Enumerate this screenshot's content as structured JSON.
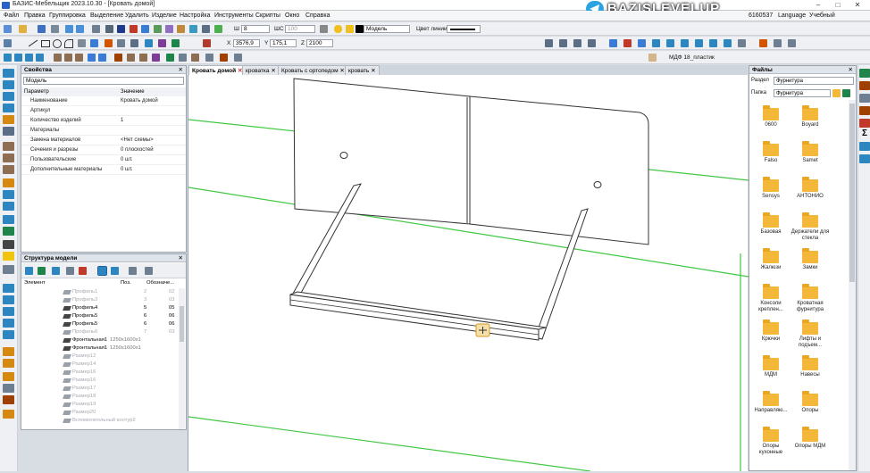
{
  "window": {
    "title": "БАЗИС-Мебельщик 2023.10.30 - [Кровать домой]",
    "account_id": "6160537",
    "language": "Language",
    "mode": "Учебный"
  },
  "banner": {
    "text": "BAZISLEVELUP"
  },
  "menu": [
    "Файл",
    "Правка",
    "Группировка",
    "Выделение",
    "Удалить",
    "Изделие",
    "Настройка",
    "Инструменты",
    "Скрипты",
    "Окно",
    "Справка"
  ],
  "toolbar": {
    "width_label": "Ш",
    "width_value": "8",
    "shs_label": "ШС",
    "shs_value": "100",
    "layer_value": "Модель",
    "line_color_label": "Цвет линии"
  },
  "coords": {
    "x_label": "X",
    "x": "3576,9",
    "y_label": "Y",
    "y": "175,1",
    "z_label": "Z",
    "z": "2100"
  },
  "material": "МДФ 18_пластик",
  "properties": {
    "title": "Свойства",
    "selector": "Модель",
    "col_param": "Параметр",
    "col_value": "Значение",
    "rows": [
      {
        "k": "Наименование",
        "v": "Кровать домой"
      },
      {
        "k": "Артикул",
        "v": ""
      },
      {
        "k": "Количество изделий",
        "v": "1"
      },
      {
        "k": "Материалы",
        "v": ""
      },
      {
        "k": "Замена материалов",
        "v": "<Нет схемы>"
      },
      {
        "k": "Сечения и разрезы",
        "v": "0 плоскостей"
      },
      {
        "k": "Пользовательские",
        "v": "0 шт."
      },
      {
        "k": "Дополнительные материалы",
        "v": "0 шт."
      }
    ]
  },
  "structure": {
    "title": "Структура модели",
    "col_element": "Элемент",
    "col_pos": "Поз.",
    "col_des": "Обозначе...",
    "rows": [
      {
        "n": "Профиль1",
        "p": "2",
        "d": "02",
        "g": true
      },
      {
        "n": "Профиль3",
        "p": "3",
        "d": "03",
        "g": true
      },
      {
        "n": "Профиль4",
        "p": "5",
        "d": "05",
        "g": false
      },
      {
        "n": "Профиль5",
        "p": "6",
        "d": "06",
        "g": false
      },
      {
        "n": "Профиль5",
        "p": "6",
        "d": "06",
        "g": false
      },
      {
        "n": "Профиль6",
        "p": "7",
        "d": "03",
        "g": true
      },
      {
        "n": "Фронтальная1",
        "p": "",
        "d": "",
        "g": false,
        "dim": "1250x1600x1"
      },
      {
        "n": "Фронтальная1",
        "p": "",
        "d": "",
        "g": false,
        "dim": "1250x1600x1"
      },
      {
        "n": "Размер12",
        "p": "",
        "d": "",
        "g": true
      },
      {
        "n": "Размер14",
        "p": "",
        "d": "",
        "g": true
      },
      {
        "n": "Размер16",
        "p": "",
        "d": "",
        "g": true
      },
      {
        "n": "Размер16",
        "p": "",
        "d": "",
        "g": true
      },
      {
        "n": "Размер17",
        "p": "",
        "d": "",
        "g": true
      },
      {
        "n": "Размер18",
        "p": "",
        "d": "",
        "g": true
      },
      {
        "n": "Размер19",
        "p": "",
        "d": "",
        "g": true
      },
      {
        "n": "Размер20",
        "p": "",
        "d": "",
        "g": true
      },
      {
        "n": "Вспомогательный контур2",
        "p": "",
        "d": "",
        "g": true
      }
    ]
  },
  "doc_tabs": [
    "Кровать домой",
    "кроватка",
    "Кровать с ортопедом",
    "кровать"
  ],
  "files": {
    "title": "Файлы",
    "section_label": "Раздел",
    "section_value": "Фурнитура",
    "folder_label": "Папка",
    "folder_value": "Фурнитура",
    "items": [
      "0600",
      "Boyard",
      "Falso",
      "Samet",
      "Sensys",
      "АНТОНИО",
      "Базовая",
      "Держатели для стекла",
      "Жалюзи",
      "Замки",
      "Консоли креплен...",
      "Кроватная фурнитура",
      "Крючки",
      "Лифты и подъем...",
      "МДМ",
      "Навесы",
      "Направляю...",
      "Опоры",
      "Опоры кухонные",
      "Опоры МДМ"
    ]
  }
}
